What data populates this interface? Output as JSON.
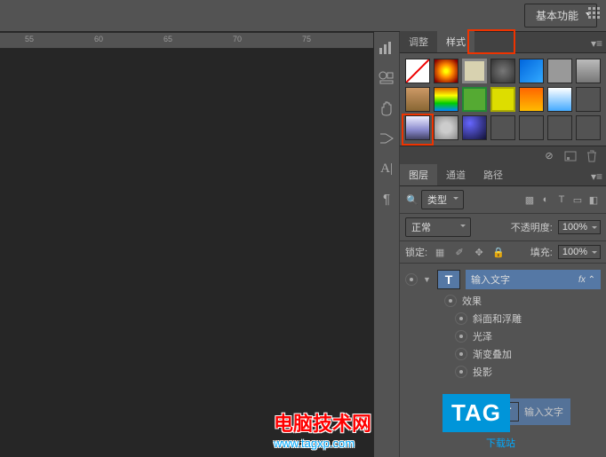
{
  "topbar": {
    "workspace_label": "基本功能"
  },
  "ruler": {
    "ticks": [
      "55",
      "60",
      "65",
      "70",
      "75"
    ]
  },
  "panels": {
    "adjust_tab": "调整",
    "styles_tab": "样式",
    "layers_tab": "图层",
    "channels_tab": "通道",
    "paths_tab": "路径"
  },
  "layer_panel": {
    "filter_label": "类型",
    "blend_mode": "正常",
    "opacity_label": "不透明度:",
    "opacity_value": "100%",
    "lock_label": "锁定:",
    "fill_label": "填充:",
    "fill_value": "100%"
  },
  "layers": {
    "text_layer_name": "输入文字",
    "text_layer_thumb": "T",
    "fx_indicator": "fx",
    "effects_label": "效果",
    "effect1": "斜面和浮雕",
    "effect2": "光泽",
    "effect3": "渐变叠加",
    "effect4": "投影"
  },
  "ghost_layer": {
    "thumb": "T",
    "name": "输入文字"
  },
  "watermark": {
    "title": "电脑技术网",
    "url": "www.tagxp.com",
    "badge": "TAG",
    "badge_sub": "下载站"
  }
}
